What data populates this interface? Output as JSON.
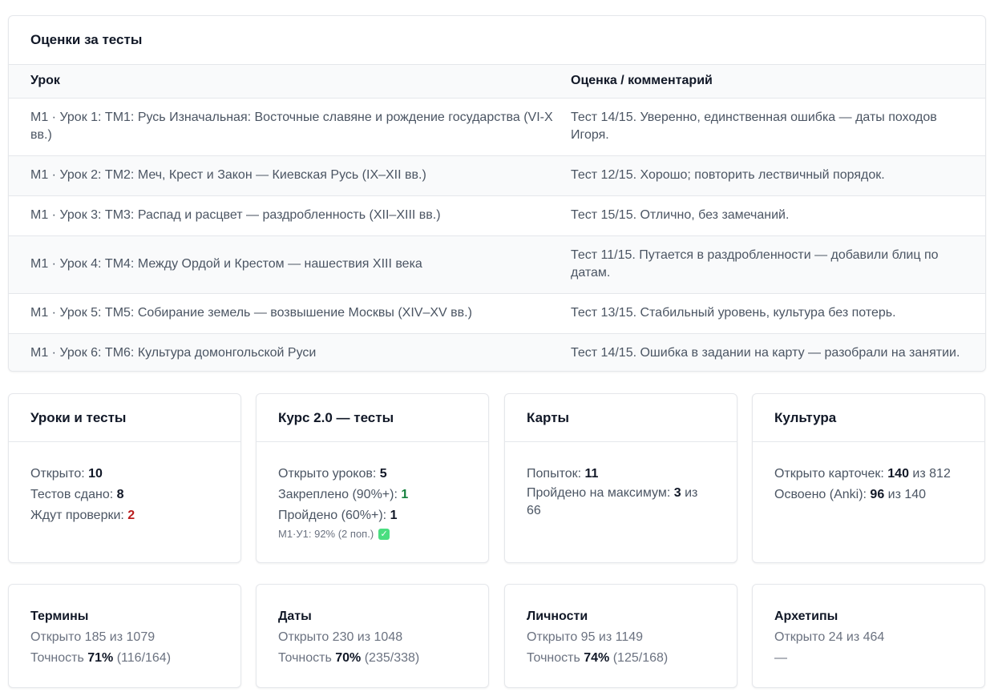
{
  "grades": {
    "title": "Оценки за тесты",
    "headers": [
      "Урок",
      "Оценка / комментарий"
    ],
    "rows": [
      {
        "lesson": "М1 · Урок 1: ТМ1: Русь Изначальная: Восточные славяне и рождение государства (VI-X вв.)",
        "grade": "Тест 14/15. Уверенно, единственная ошибка — даты походов Игоря."
      },
      {
        "lesson": "М1 · Урок 2: ТМ2: Меч, Крест и Закон — Киевская Русь (IX–XII вв.)",
        "grade": "Тест 12/15. Хорошо; повторить лествичный порядок."
      },
      {
        "lesson": "М1 · Урок 3: ТМ3: Распад и расцвет — раздробленность (XII–XIII вв.)",
        "grade": "Тест 15/15. Отлично, без замечаний."
      },
      {
        "lesson": "М1 · Урок 4: ТМ4: Между Ордой и Крестом — нашествия XIII века",
        "grade": "Тест 11/15. Путается в раздробленности — добавили блиц по датам."
      },
      {
        "lesson": "М1 · Урок 5: ТМ5: Собирание земель — возвышение Москвы (XIV–XV вв.)",
        "grade": "Тест 13/15. Стабильный уровень, культура без потерь."
      },
      {
        "lesson": "М1 · Урок 6: ТМ6: Культура домонгольской Руси",
        "grade": "Тест 14/15. Ошибка в задании на карту — разобрали на занятии."
      }
    ]
  },
  "lessons_card": {
    "title": "Уроки и тесты",
    "opened_label": "Открыто: ",
    "opened": "10",
    "passed_label": "Тестов сдано: ",
    "passed": "8",
    "pending_label": "Ждут проверки: ",
    "pending": "2"
  },
  "course_card": {
    "title": "Курс 2.0 — тесты",
    "opened_label": "Открыто уроков: ",
    "opened": "5",
    "fixed_label": "Закреплено (90%+): ",
    "fixed": "1",
    "passed_label": "Пройдено (60%+): ",
    "passed": "1",
    "note": "М1·У1: 92% (2 поп.)",
    "note_icon": "check-icon"
  },
  "maps_card": {
    "title": "Карты",
    "attempts_label": "Попыток: ",
    "attempts": "11",
    "max_label": "Пройдено на максимум: ",
    "max": "3",
    "max_of": " из 66"
  },
  "culture_card": {
    "title": "Культура",
    "cards_label": "Открыто карточек: ",
    "cards": "140",
    "cards_of": " из 812",
    "anki_label": "Освоено (Anki): ",
    "anki": "96",
    "anki_of": " из 140"
  },
  "terms_card": {
    "title": "Термины",
    "opened": "Открыто 185 из 1079",
    "acc_label": "Точность ",
    "acc": "71%",
    "acc_detail": " (116/164)"
  },
  "dates_card": {
    "title": "Даты",
    "opened": "Открыто 230 из 1048",
    "acc_label": "Точность ",
    "acc": "70%",
    "acc_detail": " (235/338)"
  },
  "persons_card": {
    "title": "Личности",
    "opened": "Открыто 95 из 1149",
    "acc_label": "Точность ",
    "acc": "74%",
    "acc_detail": " (125/168)"
  },
  "archetypes_card": {
    "title": "Архетипы",
    "opened": "Открыто 24 из 464",
    "acc_text": "—"
  },
  "colors": {
    "success": "#15803d",
    "danger": "#b91c1c",
    "check": "#4ade80"
  }
}
